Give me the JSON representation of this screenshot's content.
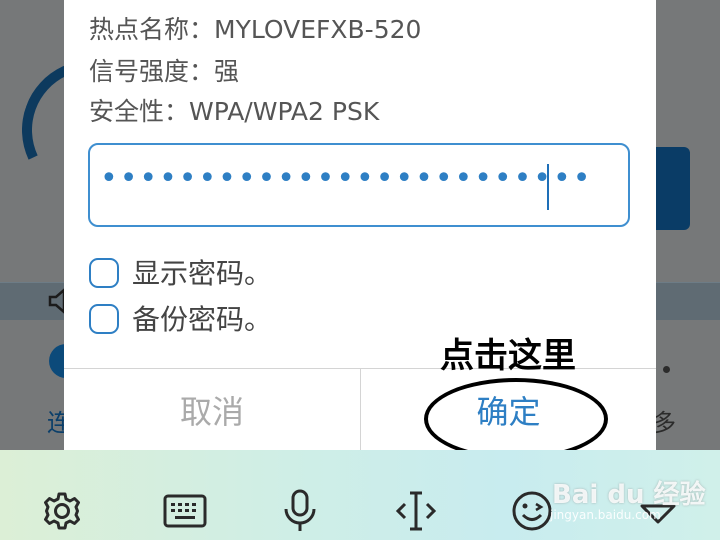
{
  "dialog": {
    "hotspot_name": "热点名称：MYLOVEFXB-520",
    "signal_strength": "信号强度：强",
    "security": "安全性：WPA/WPA2 PSK",
    "password_masked": "•••••••••••••••••••••••••",
    "show_password_label": "显示密码。",
    "backup_password_label": "备份密码。",
    "cancel_label": "取消",
    "confirm_label": "确定"
  },
  "annotation": {
    "text": "点击这里"
  },
  "background": {
    "left_text": "连",
    "right_text": "多"
  },
  "keyboard_toolbar": {
    "icons": [
      "gear-icon",
      "keyboard-icon",
      "microphone-icon",
      "cursor-icon",
      "emoji-icon",
      "chevron-down-icon"
    ]
  },
  "watermark": {
    "text": "Bai du 经验",
    "sub": "jingyan.baidu.com"
  },
  "colors": {
    "accent": "#2e7fc4",
    "dim_background": "#767879",
    "cancel_text": "#aaaaaa"
  }
}
